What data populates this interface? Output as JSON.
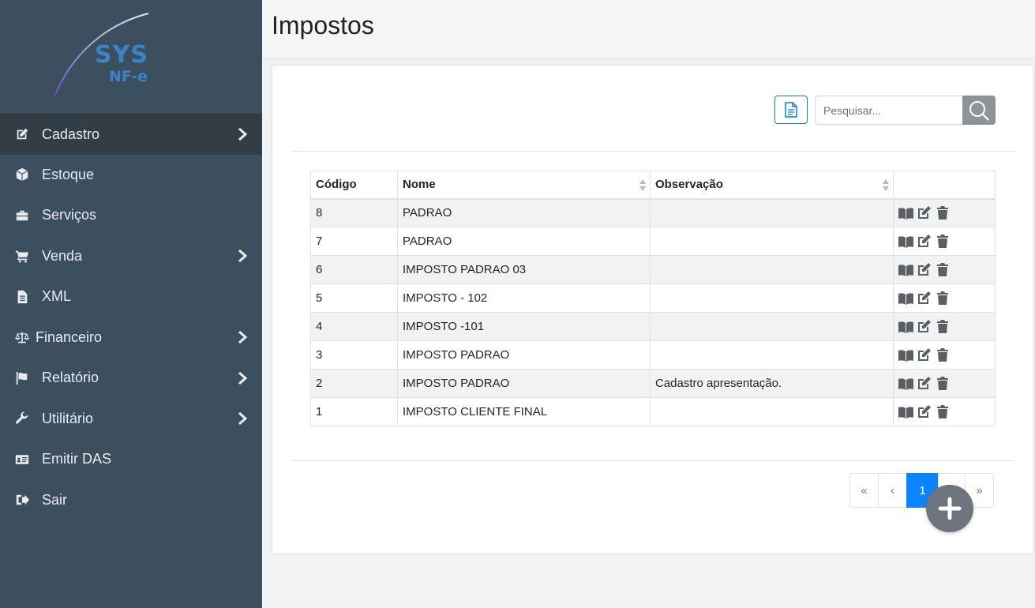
{
  "app": {
    "logo_line1": "SYS",
    "logo_line2": "NF-e"
  },
  "sidebar": {
    "items": [
      {
        "label": "Cadastro",
        "icon": "edit-icon",
        "has_chevron": true,
        "active": true
      },
      {
        "label": "Estoque",
        "icon": "box-icon",
        "has_chevron": false
      },
      {
        "label": "Serviços",
        "icon": "briefcase-icon",
        "has_chevron": false
      },
      {
        "label": "Venda",
        "icon": "cart-icon",
        "has_chevron": true
      },
      {
        "label": "XML",
        "icon": "file-icon",
        "has_chevron": false
      },
      {
        "label": "Financeiro",
        "icon": "scale-icon",
        "has_chevron": true
      },
      {
        "label": "Relatório",
        "icon": "flag-icon",
        "has_chevron": true
      },
      {
        "label": "Utilitário",
        "icon": "wrench-icon",
        "has_chevron": true
      },
      {
        "label": "Emitir DAS",
        "icon": "id-card-icon",
        "has_chevron": false
      },
      {
        "label": "Sair",
        "icon": "sign-out-icon",
        "has_chevron": false
      }
    ]
  },
  "page": {
    "title": "Impostos"
  },
  "search": {
    "placeholder": "Pesquisar..."
  },
  "table": {
    "columns": [
      "Código",
      "Nome",
      "Observação",
      ""
    ],
    "rows": [
      {
        "codigo": "8",
        "nome": "PADRAO",
        "observacao": ""
      },
      {
        "codigo": "7",
        "nome": "PADRAO",
        "observacao": ""
      },
      {
        "codigo": "6",
        "nome": "IMPOSTO PADRAO 03",
        "observacao": ""
      },
      {
        "codigo": "5",
        "nome": "IMPOSTO - 102",
        "observacao": ""
      },
      {
        "codigo": "4",
        "nome": "IMPOSTO -101",
        "observacao": ""
      },
      {
        "codigo": "3",
        "nome": "IMPOSTO PADRAO",
        "observacao": ""
      },
      {
        "codigo": "2",
        "nome": "IMPOSTO PADRAO",
        "observacao": "Cadastro apresentação."
      },
      {
        "codigo": "1",
        "nome": "IMPOSTO CLIENTE FINAL",
        "observacao": ""
      }
    ],
    "row_actions": [
      "book-icon",
      "edit-icon",
      "trash-icon"
    ]
  },
  "pagination": {
    "first": "«",
    "prev": "‹",
    "current": "1",
    "next": "›",
    "last": "»"
  },
  "colors": {
    "sidebar_bg": "#3c4f5e",
    "active_bg": "#333d45",
    "accent": "#0d84ff",
    "logo": "#3a84c4"
  }
}
